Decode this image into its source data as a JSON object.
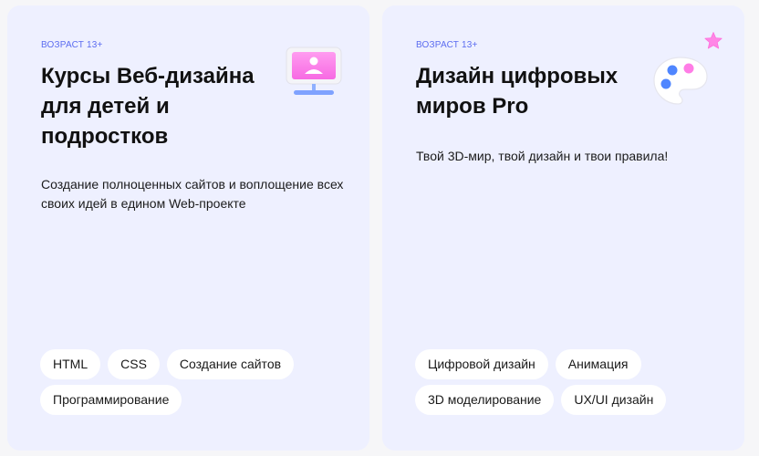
{
  "cards": [
    {
      "age": "ВОЗРАСТ  13+",
      "title": "Курсы Веб-дизайна для детей и подростков",
      "description": "Создание полноценных сайтов и воплощение всех своих идей в едином Web-проекте",
      "icon": "monitor-icon",
      "tags": [
        "HTML",
        "CSS",
        "Создание сайтов",
        "Программирование"
      ]
    },
    {
      "age": "ВОЗРАСТ  13+",
      "title": "Дизайн цифровых миров Pro",
      "description": "Твой 3D-мир, твой дизайн и твои правила!",
      "icon": "palette-icon",
      "tags": [
        "Цифровой дизайн",
        "Анимация",
        "3D моделирование",
        "UX/UI дизайн"
      ]
    }
  ],
  "colors": {
    "card_bg": "#eef0ff",
    "accent": "#5b6cf0",
    "tag_bg": "#ffffff",
    "icon_pink": "#ff7de6",
    "icon_blue": "#4f86ff"
  }
}
